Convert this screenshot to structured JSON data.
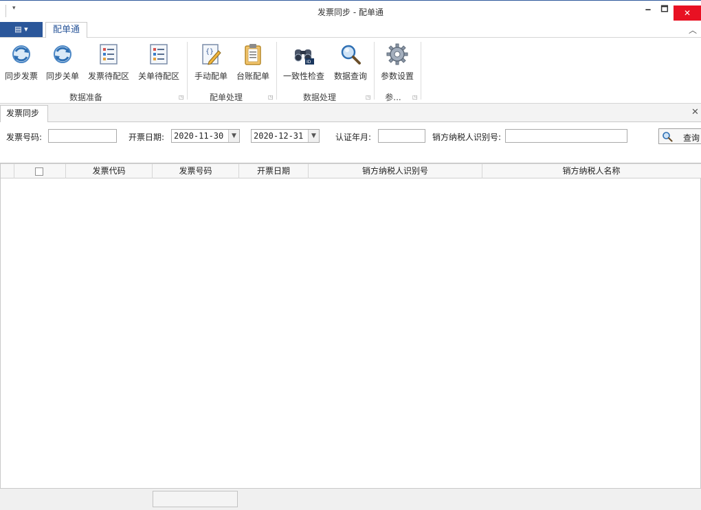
{
  "window": {
    "title": "发票同步 - 配单通",
    "min": "🗕",
    "max": "🗖",
    "close": "✕",
    "qat_arrow": "▾"
  },
  "ribbon_tabs": {
    "app_menu": "▤ ▾",
    "main_tab": "配单通",
    "collapse": "︿"
  },
  "ribbon": {
    "buttons": [
      {
        "label": "同步发票",
        "icon": "sync-icon"
      },
      {
        "label": "同步关单",
        "icon": "sync-icon"
      },
      {
        "label": "发票待配区",
        "icon": "list-icon"
      },
      {
        "label": "关单待配区",
        "icon": "list-icon"
      },
      {
        "label": "手动配单",
        "icon": "edit-icon"
      },
      {
        "label": "台账配单",
        "icon": "clipboard-icon"
      },
      {
        "label": "一致性检查",
        "icon": "binoculars-icon"
      },
      {
        "label": "数据查询",
        "icon": "magnifier-icon"
      },
      {
        "label": "参数设置",
        "icon": "gear-icon"
      }
    ],
    "groups": [
      "数据准备",
      "配单处理",
      "数据处理",
      "参..."
    ],
    "launcher": "◳"
  },
  "doc_tab": {
    "label": "发票同步",
    "close": "✕"
  },
  "filters": {
    "invoice_no_label": "发票号码:",
    "invoice_no_value": "",
    "issue_date_label": "开票日期:",
    "date_from": "2020-11-30",
    "date_to": "2020-12-31",
    "cert_month_label": "认证年月:",
    "cert_month_value": "",
    "seller_tax_id_label": "销方纳税人识别号:",
    "seller_tax_id_value": "",
    "query_label": "查询",
    "dropdown_arrow": "▼"
  },
  "grid": {
    "columns": [
      "发票代码",
      "发票号码",
      "开票日期",
      "销方纳税人识别号",
      "销方纳税人名称"
    ],
    "rows": []
  },
  "colors": {
    "accent": "#2b579a",
    "close_red": "#e81123"
  }
}
